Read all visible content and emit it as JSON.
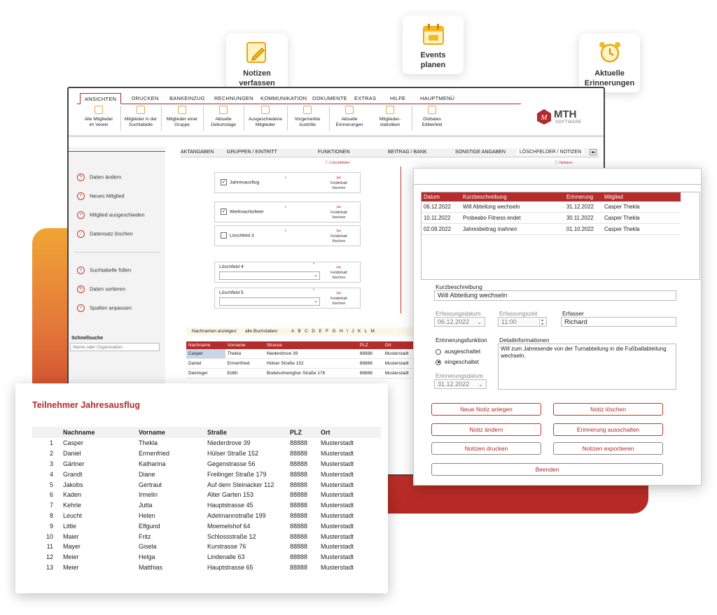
{
  "feature_cards": [
    {
      "label_line1": "Notizen",
      "label_line2": "verfassen",
      "icon": "pencil-note-icon"
    },
    {
      "label_line1": "Events",
      "label_line2": "planen",
      "icon": "calendar-icon"
    },
    {
      "label_line1": "Aktuelle",
      "label_line2": "Erinnerungen",
      "icon": "alarm-clock-icon"
    }
  ],
  "menu": [
    "ANSICHTEN",
    "DRUCKEN",
    "BANKEINZUG",
    "RECHNUNGEN",
    "KOMMUNIKATION",
    "DOKUMENTE",
    "EXTRAS",
    "HILFE",
    "HAUPTMENÜ"
  ],
  "ribbon": [
    {
      "l1": "Alle Mitglieder",
      "l2": "im Verein"
    },
    {
      "l1": "Mitglieder in der",
      "l2": "Suchtabelle"
    },
    {
      "l1": "Mitglieder einer",
      "l2": "Gruppe"
    },
    {
      "l1": "Aktuelle",
      "l2": "Geburtstage"
    },
    {
      "l1": "Ausgeschiedene",
      "l2": "Mitglieder"
    },
    {
      "l1": "Vorgemerkte",
      "l2": "Austritte"
    },
    {
      "l1": "Aktuelle",
      "l2": "Erinnerungen"
    },
    {
      "l1": "Mitglieder-",
      "l2": "statistiken"
    },
    {
      "l1": "Globales",
      "l2": "Editierfeld"
    }
  ],
  "logo": {
    "brand": "MTH",
    "sub": "SOFTWARE"
  },
  "sidebar": {
    "items_top": [
      "Daten ändern",
      "Neues Mitglied",
      "Mitglied ausgeschieden",
      "Datensatz löschen"
    ],
    "items_bottom": [
      "Suchtabelle füllen",
      "Daten sortieren",
      "Spalten anpassen"
    ],
    "search_title": "Schnellsuche",
    "search_placeholder": "Name oder Organisation"
  },
  "tabs": [
    "AKTANGABEN",
    "GRUPPEN / EINTRITT",
    "FUNKTIONEN",
    "BEITRAG / BANK",
    "SONSTIGE ANGABEN",
    "LÖSCHFELDER / NOTIZEN"
  ],
  "help_links": {
    "loeschfelder": "Löschfelder",
    "notizen": "Notizen"
  },
  "fields": {
    "f1": "Jahresausflug",
    "f2": "Weihnachtsfeier",
    "f3": "Löschfeld 3",
    "f4": "Löschfeld 4",
    "f5": "Löschfeld 5",
    "del_l1": "Feldinhalt",
    "del_l2": "löschen"
  },
  "alpha": {
    "label": "Nachnamen anzeigen:",
    "all": "alle Buchstaben",
    "letters": "A   B   C   D   E   F   G   H   I   J   K   L   M"
  },
  "grid": {
    "headers": [
      "Nachname",
      "Vorname",
      "Strasse",
      "PLZ",
      "Ort"
    ],
    "rows": [
      [
        "Casper",
        "Thekla",
        "Niederdrove 39",
        "88888",
        "Musterstadt"
      ],
      [
        "Daniel",
        "Ermenfried",
        "Hülser Straße 152",
        "88888",
        "Musterstadt"
      ],
      [
        "Deininger",
        "Edith",
        "Bodelschwingher Straße 176",
        "88888",
        "Musterstadt"
      ]
    ]
  },
  "participants": {
    "title": "Teilnehmer Jahresausflug",
    "headers": [
      "Nachname",
      "Vorname",
      "Straße",
      "PLZ",
      "Ort"
    ],
    "rows": [
      [
        "1",
        "Casper",
        "Thekla",
        "Niederdrove 39",
        "88888",
        "Musterstadt"
      ],
      [
        "2",
        "Daniel",
        "Ermenfried",
        "Hülser Straße 152",
        "88888",
        "Musterstadt"
      ],
      [
        "3",
        "Gärtner",
        "Katharina",
        "Gegenstrasse 56",
        "88888",
        "Musterstadt"
      ],
      [
        "4",
        "Grandt",
        "Diane",
        "Freilinger Straße 179",
        "88888",
        "Musterstadt"
      ],
      [
        "5",
        "Jakobs",
        "Gertraut",
        "Auf dem Steinacker 112",
        "88888",
        "Musterstadt"
      ],
      [
        "6",
        "Kaden",
        "Irmelin",
        "Alter Garten 153",
        "88888",
        "Musterstadt"
      ],
      [
        "7",
        "Kehrle",
        "Jutta",
        "Hauptstrasse 45",
        "88888",
        "Musterstadt"
      ],
      [
        "8",
        "Leucht",
        "Helen",
        "Adelmannstraße 199",
        "88888",
        "Musterstadt"
      ],
      [
        "9",
        "Little",
        "Elfgund",
        "Moemelshof 64",
        "88888",
        "Musterstadt"
      ],
      [
        "10",
        "Maier",
        "Fritz",
        "Schlossstraße 12",
        "88888",
        "Musterstadt"
      ],
      [
        "11",
        "Mayer",
        "Gisela",
        "Kurstrasse 76",
        "88888",
        "Musterstadt"
      ],
      [
        "12",
        "Meier",
        "Helga",
        "Lindenalle 63",
        "88888",
        "Musterstadt"
      ],
      [
        "13",
        "Meier",
        "Matthias",
        "Hauptstrasse 65",
        "88888",
        "Musterstadt"
      ]
    ]
  },
  "notes": {
    "headers": [
      "Datum",
      "Kurzbeschreibung",
      "Erinnerung",
      "Mitglied"
    ],
    "rows": [
      [
        "06.12.2022",
        "Will Abteilung wechseln",
        "31.12.2022",
        "Casper Thekla"
      ],
      [
        "10.11.2022",
        "Probeabo Fitness endet",
        "30.11.2022",
        "Casper Thekla"
      ],
      [
        "02.09.2022",
        "Jahresbeitrag mahnen",
        "01.10.2022",
        "Casper Thekla"
      ]
    ],
    "kurz_label": "Kurzbeschreibung",
    "kurz_value": "Will Abteilung wechseln",
    "erf_datum_label": "Erfassungsdatum",
    "erf_datum_value": "06.12.2022",
    "erf_zeit_label": "Erfassungszeit",
    "erf_zeit_value": "11:00",
    "erfasser_label": "Erfasser",
    "erfasser_value": "Richard",
    "erinnerung_label": "Erinnerungsfunktion",
    "radio_off": "ausgeschaltet",
    "radio_on": "eingeschaltet",
    "erinnerungsdatum_label": "Erinnerungsdatum",
    "erinnerungsdatum_value": "31.12.2022",
    "detail_label": "Detailinformationen",
    "detail_value": "Will zum Jahresende von der Turnabteilung in die Fußballabteilung wechseln.",
    "buttons": {
      "new": "Neue Notiz anlegen",
      "delete": "Notiz löschen",
      "edit": "Notiz ändern",
      "reminder_off": "Erinnerung ausschalten",
      "print": "Notizen drucken",
      "export": "Notizen exportieren",
      "close": "Beenden"
    }
  }
}
